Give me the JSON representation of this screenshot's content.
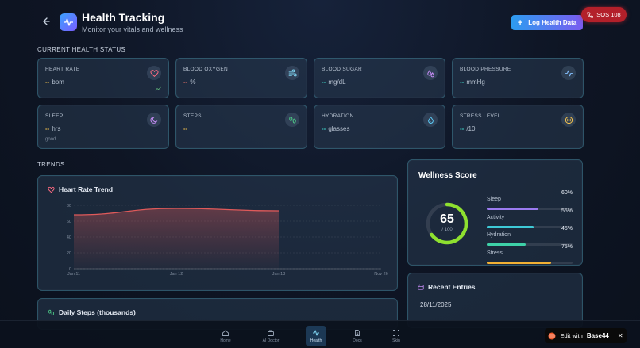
{
  "header": {
    "title": "Health Tracking",
    "subtitle": "Monitor your vitals and wellness",
    "log_button": "Log Health Data",
    "sos_button": "SOS 108"
  },
  "sections": {
    "current": "CURRENT HEALTH STATUS",
    "trends": "TRENDS"
  },
  "stats": [
    {
      "label": "HEART RATE",
      "value": "--",
      "unit": "bpm",
      "icon": "heart-icon",
      "color": "#f2c14e",
      "iconColor": "#ff6b81"
    },
    {
      "label": "BLOOD OXYGEN",
      "value": "--",
      "unit": "%",
      "icon": "wind-icon",
      "color": "#f2766b",
      "iconColor": "#7fd3f0"
    },
    {
      "label": "BLOOD SUGAR",
      "value": "--",
      "unit": "mg/dL",
      "icon": "droplets-icon",
      "color": "#3ed1c6",
      "iconColor": "#c58cf5"
    },
    {
      "label": "BLOOD PRESSURE",
      "value": "--",
      "unit": "mmHg",
      "icon": "pulse-icon",
      "color": "#3ed1c6",
      "iconColor": "#7fb8f5"
    },
    {
      "label": "SLEEP",
      "value": "--",
      "unit": "hrs",
      "note": "good",
      "icon": "moon-icon",
      "color": "#f2c14e",
      "iconColor": "#c58cf5"
    },
    {
      "label": "STEPS",
      "value": "--",
      "unit": "",
      "icon": "footprints-icon",
      "color": "#f2c14e",
      "iconColor": "#4fd18b"
    },
    {
      "label": "HYDRATION",
      "value": "--",
      "unit": "glasses",
      "icon": "water-drop-icon",
      "color": "#3ed1c6",
      "iconColor": "#5cc9f5"
    },
    {
      "label": "STRESS LEVEL",
      "value": "--",
      "unit": "/10",
      "icon": "brain-icon",
      "color": "#3ed1c6",
      "iconColor": "#f2c14e"
    }
  ],
  "heart_chart": {
    "title": "Heart Rate Trend",
    "chart_data": {
      "type": "area",
      "x": [
        "Jan 11",
        "Jan 12",
        "Jan 13",
        "Nov 26"
      ],
      "values": [
        68,
        76,
        73,
        null
      ],
      "ylim": [
        0,
        80
      ],
      "yticks": [
        "0",
        "20",
        "40",
        "60",
        "80"
      ],
      "color": "#e05a5a"
    }
  },
  "steps_chart": {
    "title": "Daily Steps (thousands)"
  },
  "wellness": {
    "title": "Wellness Score",
    "score": "65",
    "max": "/ 100",
    "score_value": 65,
    "metrics": [
      {
        "name": "Sleep",
        "pct": "60%",
        "value": 60,
        "color": "#9b7bf0"
      },
      {
        "name": "Activity",
        "pct": "55%",
        "value": 55,
        "color": "#3ec9d6"
      },
      {
        "name": "Hydration",
        "pct": "45%",
        "value": 45,
        "color": "#3ed1a8"
      },
      {
        "name": "Stress",
        "pct": "75%",
        "value": 75,
        "color": "#f2b134"
      }
    ]
  },
  "recent": {
    "title": "Recent Entries",
    "date": "28/11/2025"
  },
  "nav": [
    {
      "label": "Home",
      "icon": "home-icon"
    },
    {
      "label": "AI Doctor",
      "icon": "briefcase-icon"
    },
    {
      "label": "Health",
      "icon": "activity-icon",
      "active": true
    },
    {
      "label": "Docs",
      "icon": "document-icon"
    },
    {
      "label": "Skin",
      "icon": "scan-icon"
    }
  ],
  "badge": {
    "prefix": "Edit with",
    "brand": "Base44"
  }
}
